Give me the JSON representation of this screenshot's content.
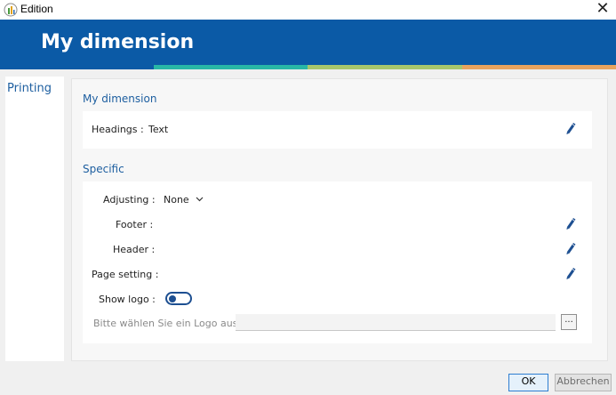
{
  "window": {
    "title": "Edition",
    "close_glyph": "✕"
  },
  "header": {
    "title": "My dimension"
  },
  "sidebar": {
    "items": [
      {
        "label": "Printing"
      }
    ]
  },
  "sections": {
    "dimension": {
      "title": "My dimension",
      "headings_label": "Headings :",
      "headings_value": "Text"
    },
    "specific": {
      "title": "Specific",
      "adjusting_label": "Adjusting :",
      "adjusting_value": "None",
      "footer_label": "Footer :",
      "header_label": "Header :",
      "page_setting_label": "Page setting :",
      "show_logo_label": "Show logo :",
      "show_logo_on": false,
      "logo_label": "Bitte wählen Sie ein Logo aus:",
      "logo_value": "",
      "browse_label": "..."
    }
  },
  "buttons": {
    "ok": "OK",
    "cancel": "Abbrechen"
  },
  "colors": {
    "accent": "#0b5aa6",
    "stripe_teal": "#28b7a6",
    "stripe_green": "#a7c66c",
    "stripe_orange": "#e8a35e",
    "link_blue": "#1e5fa0"
  },
  "icons": {
    "app": "app-logo-icon",
    "edit": "pencil-icon",
    "close": "close-icon",
    "dropdown": "chevron-down-icon"
  }
}
